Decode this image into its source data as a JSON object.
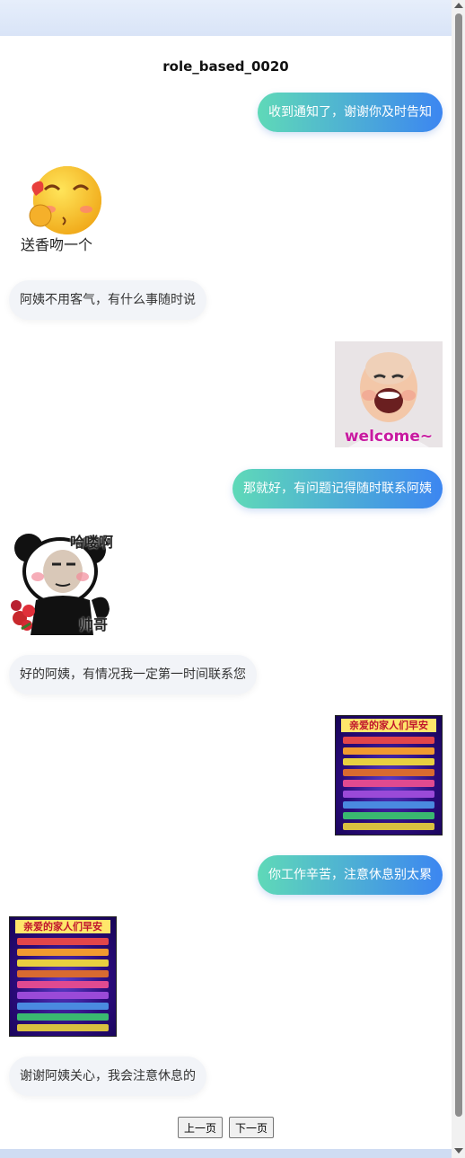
{
  "title": "role_based_0020",
  "messages": [
    {
      "side": "right",
      "type": "text",
      "text": "收到通知了，谢谢你及时告知"
    },
    {
      "side": "left",
      "type": "sticker",
      "icon": "kiss-emoji-icon",
      "caption": "送香吻一个"
    },
    {
      "side": "left",
      "type": "text",
      "text": "阿姨不用客气，有什么事随时说"
    },
    {
      "side": "right",
      "type": "sticker",
      "icon": "laughing-baby-icon",
      "caption": "welcome~"
    },
    {
      "side": "right",
      "type": "text",
      "text": "那就好，有问题记得随时联系阿姨"
    },
    {
      "side": "left",
      "type": "sticker",
      "icon": "panda-with-roses-icon",
      "caption_top": "哈喽啊",
      "caption_bottom": "帅哥"
    },
    {
      "side": "left",
      "type": "text",
      "text": "好的阿姨，有情况我一定第一时间联系您"
    },
    {
      "side": "right",
      "type": "sticker",
      "icon": "good-morning-poster-icon",
      "caption": "亲爱的家人们早安"
    },
    {
      "side": "right",
      "type": "text",
      "text": "你工作辛苦，注意休息别太累"
    },
    {
      "side": "left",
      "type": "sticker",
      "icon": "good-morning-poster-icon",
      "caption": "亲爱的家人们早安"
    },
    {
      "side": "left",
      "type": "text",
      "text": "谢谢阿姨关心，我会注意休息的"
    }
  ],
  "pager": {
    "prev_label": "上一页",
    "next_label": "下一页"
  },
  "colors": {
    "bubble_gradient_start": "#5fd9b8",
    "bubble_gradient_end": "#3c86f1",
    "left_bubble": "#f2f4f8"
  }
}
